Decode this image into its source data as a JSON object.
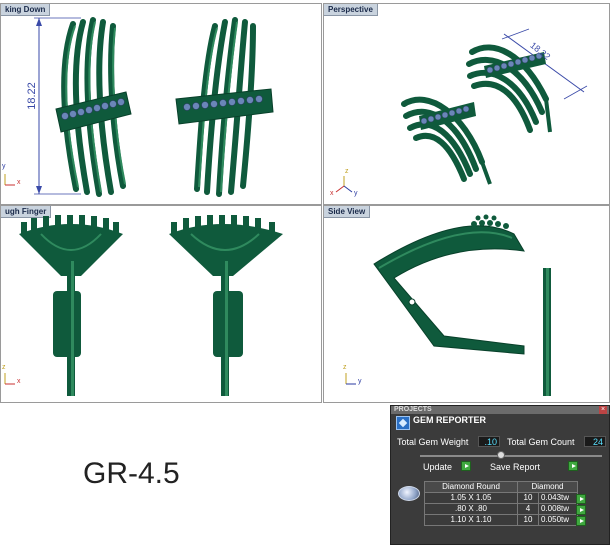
{
  "viewports": {
    "top_left": {
      "label": "king Down",
      "dimension": "18.22",
      "axis_y": "y",
      "axis_x": "x"
    },
    "top_right": {
      "label": "Perspective",
      "dimension": "18.22",
      "axis_z": "z",
      "axis_x": "x",
      "axis_y": "y"
    },
    "bottom_left": {
      "label": "ugh Finger",
      "axis_z": "z",
      "axis_x": "x"
    },
    "bottom_right": {
      "label": "Side View",
      "axis_z": "z",
      "axis_y": "y"
    }
  },
  "model_label": "GR-4.5",
  "gem_reporter": {
    "top_bar": "PROJECTS",
    "title": "GEM REPORTER",
    "total_weight_label": "Total Gem Weight",
    "total_weight_value": ".10",
    "total_count_label": "Total Gem Count",
    "total_count_value": "24",
    "update_label": "Update",
    "save_report_label": "Save Report",
    "table_headers": [
      "Diamond Round",
      "Diamond"
    ],
    "rows": [
      {
        "size": "1.05 X 1.05",
        "count": "10",
        "weight": "0.043tw"
      },
      {
        "size": ".80 X .80",
        "count": "4",
        "weight": "0.008tw"
      },
      {
        "size": "1.10 X 1.10",
        "count": "10",
        "weight": "0.050tw"
      }
    ]
  },
  "colors": {
    "metal": "#0f5a3c",
    "metal_highlight": "#2f8a5e",
    "gem": "#6a86b8",
    "dimension": "#3a4aa8"
  }
}
